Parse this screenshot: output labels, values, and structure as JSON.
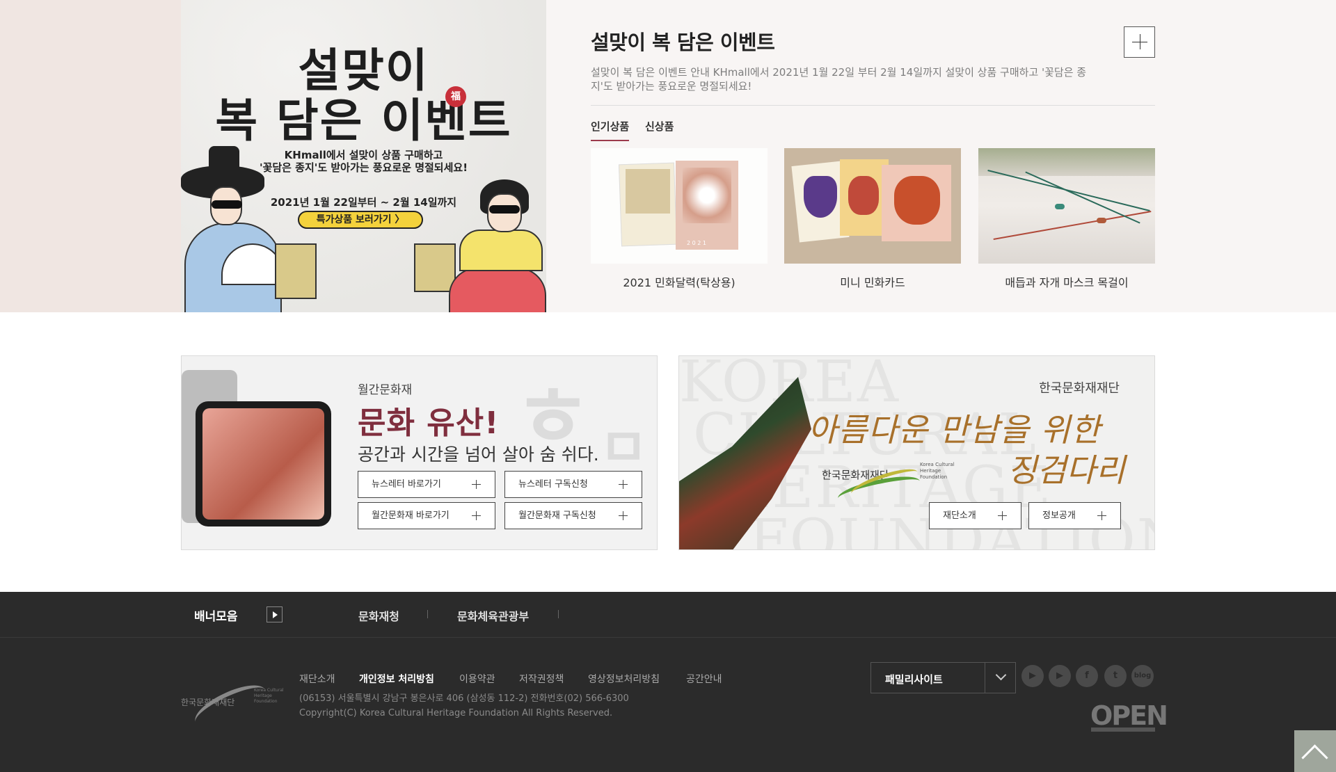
{
  "event": {
    "banner": {
      "title_line1": "설맞이",
      "title_line2": "복 담은 이벤트",
      "seal": "福",
      "sub_line1": "KHmall에서 설맞이 상품 구매하고",
      "sub_line2": "'꽃담은 종지'도 받아가는 풍요로운 명절되세요!",
      "date": "2021년 1월 22일부터 ~ 2월 14일까지",
      "cta": "특가상품 보러가기 〉"
    },
    "title": "설맞이 복 담은 이벤트",
    "description": "설맞이 복 담은 이벤트 안내 KHmall에서 2021년 1월 22일 부터 2월 14일까지 설맞이 상품 구매하고 '꽃담은 종지'도 받아가는 풍요로운 명절되세요!",
    "tabs": [
      {
        "label": "인기상품",
        "active": true
      },
      {
        "label": "신상품",
        "active": false
      }
    ],
    "products": [
      {
        "name": "2021 민화달력(탁상용)",
        "cal_year": "2 0 2 1"
      },
      {
        "name": "미니 민화카드"
      },
      {
        "name": "매듭과 자개 마스크 목걸이"
      }
    ]
  },
  "magazine": {
    "label": "월간문화재",
    "headline": "문화 유산!",
    "tagline": "공간과 시간을 넘어 살아 숨 쉬다.",
    "ghost_chars": [
      "ㅎ",
      "ㅁ"
    ],
    "buttons": [
      "뉴스레터 바로가기",
      "뉴스레터 구독신청",
      "월간문화재 바로가기",
      "월간문화재 구독신청"
    ]
  },
  "foundation": {
    "bg_text_lines": [
      "KOREA",
      "CULTURAL",
      "HERITAGE",
      "FOUNDATION"
    ],
    "org": "한국문화재재단",
    "slogan_line1": "아름다운 만남을 위한",
    "slogan_line2": "징검다리",
    "logo_ko": "한국문화재재단",
    "logo_en": "Korea Cultural Heritage Foundation",
    "buttons": [
      "재단소개",
      "정보공개"
    ]
  },
  "footer": {
    "banner_collection": "배너모음",
    "links": [
      "문화재청",
      "문화체육관광부"
    ],
    "logo_ko": "한국문화재재단",
    "logo_en": "Korea Cultural Heritage Foundation",
    "nav": [
      "재단소개",
      "개인정보 처리방침",
      "이용약관",
      "저작권정책",
      "영상정보처리방침",
      "공간안내"
    ],
    "address": "(06153) 서울특별시 강남구 봉은사로 406 (삼성동 112-2) 전화번호(02) 566-6300",
    "copyright": "Copyright(C) Korea Cultural Heritage Foundation All Rights Reserved.",
    "family_site": "패밀리사이트",
    "sns": [
      "youtube",
      "play",
      "facebook",
      "twitter",
      "blog"
    ],
    "sns_glyphs": [
      "▶",
      "▶",
      "f",
      "t",
      "blog"
    ],
    "open_mark": "OPEN"
  },
  "colors": {
    "accent": "#9c3a4c",
    "headline": "#7f2e3e",
    "slogan": "#a8702a",
    "footer_bg": "#2b2b2b"
  }
}
